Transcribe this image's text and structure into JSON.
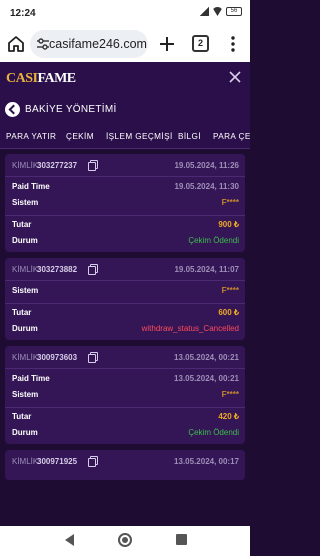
{
  "status_bar": {
    "time": "12:24",
    "battery": "56"
  },
  "browser": {
    "url": "casifame246.com",
    "tab_count": "2"
  },
  "app": {
    "logo_part1": "CASI",
    "logo_part2": "FAME",
    "title": "BAKİYE YÖNETİMİ",
    "tabs": [
      "PARA YATIR",
      "ÇEKİM",
      "İŞLEM GEÇMİŞİ",
      "BİLGİ",
      "PARA ÇEK"
    ]
  },
  "transactions": [
    {
      "id_label": "KİMLİK:",
      "id": "303277237",
      "date": "19.05.2024, 11:26",
      "rows": [
        {
          "label": "Paid Time",
          "value": "19.05.2024, 11:30",
          "kind": "date"
        },
        {
          "label": "Sistem",
          "value": "F****",
          "kind": "masked"
        },
        {
          "label": "Tutar",
          "value": "900 ₺",
          "kind": "amount"
        },
        {
          "label": "Durum",
          "value": "Çekim Ödendi",
          "kind": "ok"
        }
      ]
    },
    {
      "id_label": "KİMLİK:",
      "id": "303273882",
      "date": "19.05.2024, 11:07",
      "rows": [
        {
          "label": "Sistem",
          "value": "F****",
          "kind": "masked"
        },
        {
          "label": "Tutar",
          "value": "600 ₺",
          "kind": "amount"
        },
        {
          "label": "Durum",
          "value": "withdraw_status_Cancelled",
          "kind": "cancel"
        }
      ]
    },
    {
      "id_label": "KİMLİK:",
      "id": "300973603",
      "date": "13.05.2024, 00:21",
      "rows": [
        {
          "label": "Paid Time",
          "value": "13.05.2024, 00:21",
          "kind": "date"
        },
        {
          "label": "Sistem",
          "value": "F****",
          "kind": "masked"
        },
        {
          "label": "Tutar",
          "value": "420 ₺",
          "kind": "amount"
        },
        {
          "label": "Durum",
          "value": "Çekim Ödendi",
          "kind": "ok"
        }
      ]
    },
    {
      "id_label": "KİMLİK:",
      "id": "300971925",
      "date": "13.05.2024, 00:17",
      "rows": []
    }
  ]
}
